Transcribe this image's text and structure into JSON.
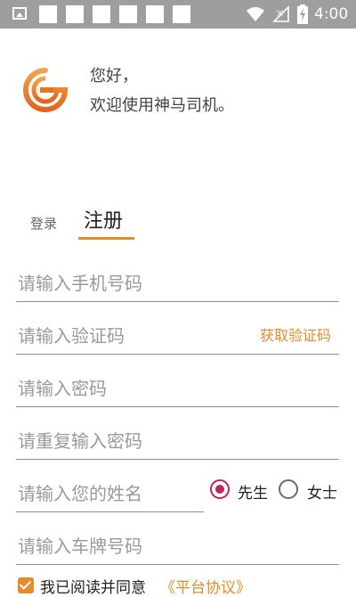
{
  "status_bar": {
    "time": "4:00"
  },
  "header": {
    "greeting_line1": "您好，",
    "greeting_line2": "欢迎使用神马司机。"
  },
  "tabs": {
    "login": "登录",
    "register": "注册"
  },
  "form": {
    "phone_placeholder": "请输入手机号码",
    "code_placeholder": "请输入验证码",
    "get_code_label": "获取验证码",
    "password_placeholder": "请输入密码",
    "repeat_password_placeholder": "请重复输入密码",
    "name_placeholder": "请输入您的姓名",
    "plate_placeholder": "请输入车牌号码",
    "gender": {
      "male": "先生",
      "female": "女士",
      "selected": "先生"
    }
  },
  "agreement": {
    "text": "我已阅读并同意",
    "link": "《平台协议》",
    "checked": true
  },
  "colors": {
    "accent": "#e48c2a",
    "radio_selected": "#c0245c",
    "status_bar": "#9e9e9e"
  }
}
